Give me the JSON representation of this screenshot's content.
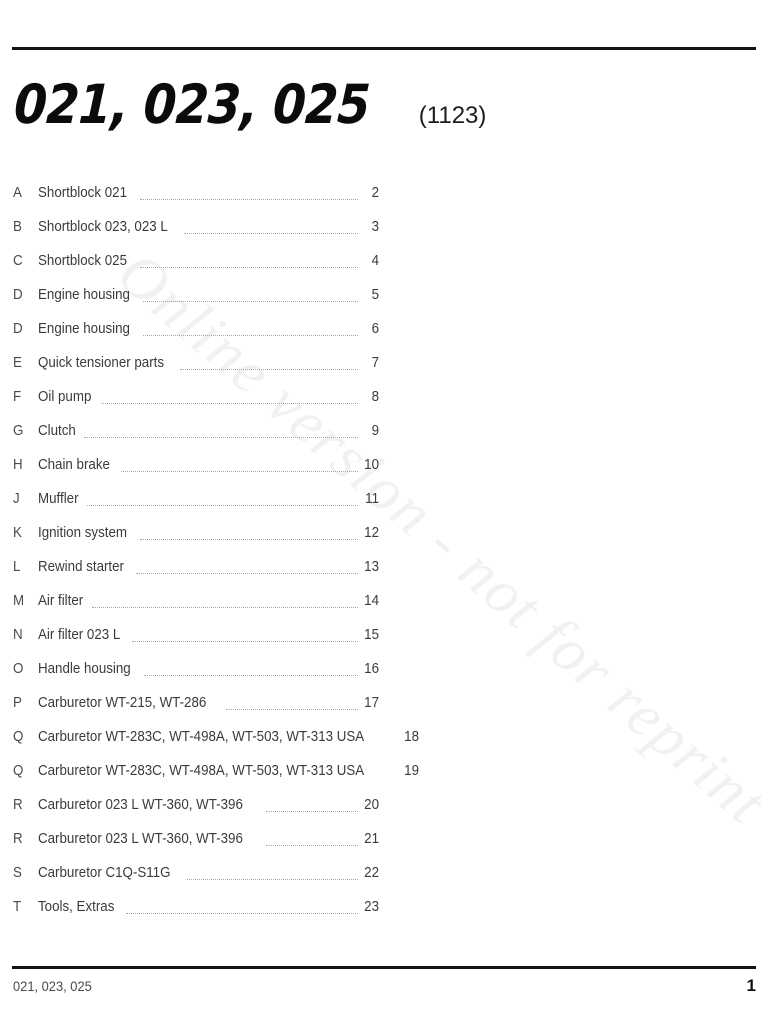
{
  "watermark": {
    "text": "Online version - not for reprint"
  },
  "header": {
    "title": "021, 023, 025",
    "code": "(1123)"
  },
  "toc": {
    "rows": [
      {
        "letter": "A",
        "label": "Shortblock 021",
        "page": "2"
      },
      {
        "letter": "B",
        "label": "Shortblock 023, 023 L",
        "page": "3"
      },
      {
        "letter": "C",
        "label": "Shortblock 025",
        "page": "4"
      },
      {
        "letter": "D",
        "label": "Engine housing",
        "page": "5"
      },
      {
        "letter": "D",
        "label": "Engine housing",
        "page": "6"
      },
      {
        "letter": "E",
        "label": "Quick tensioner parts",
        "page": "7"
      },
      {
        "letter": "F",
        "label": "Oil pump",
        "page": "8"
      },
      {
        "letter": "G",
        "label": "Clutch",
        "page": "9"
      },
      {
        "letter": "H",
        "label": "Chain brake",
        "page": "10"
      },
      {
        "letter": "J",
        "label": "Muffler",
        "page": "11"
      },
      {
        "letter": "K",
        "label": "Ignition system",
        "page": "12"
      },
      {
        "letter": "L",
        "label": "Rewind starter",
        "page": "13"
      },
      {
        "letter": "M",
        "label": "Air filter",
        "page": "14"
      },
      {
        "letter": "N",
        "label": "Air filter 023 L",
        "page": "15"
      },
      {
        "letter": "O",
        "label": "Handle housing",
        "page": "16"
      },
      {
        "letter": "P",
        "label": "Carburetor WT-215, WT-286",
        "page": "17"
      },
      {
        "letter": "Q",
        "label": "Carburetor WT-283C, WT-498A, WT-503, WT-313 USA",
        "page": "18"
      },
      {
        "letter": "Q",
        "label": "Carburetor WT-283C, WT-498A, WT-503, WT-313 USA",
        "page": "19"
      },
      {
        "letter": "R",
        "label": "Carburetor 023 L WT-360, WT-396",
        "page": "20"
      },
      {
        "letter": "R",
        "label": "Carburetor 023 L WT-360, WT-396",
        "page": "21"
      },
      {
        "letter": "S",
        "label": "Carburetor C1Q-S11G",
        "page": "22"
      },
      {
        "letter": "T",
        "label": "Tools, Extras",
        "page": "23"
      }
    ]
  },
  "footer": {
    "left": "021, 023, 025",
    "page_number": "1"
  }
}
